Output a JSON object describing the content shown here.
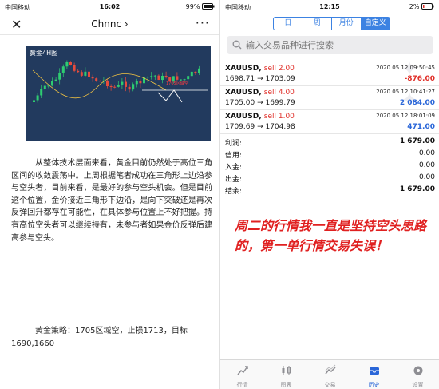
{
  "left": {
    "status": {
      "carrier": "中国移动",
      "time": "16:02",
      "battery": "99%"
    },
    "nav": {
      "title": "Chnnc",
      "close_icon": "close-icon",
      "more_icon": "more-icon"
    },
    "chart": {
      "title": "黄金4H图",
      "annotation": "1705区域空"
    },
    "article": "从整体技术层面来看，黄金目前仍然处于高位三角区间的收敛震荡中。上周根据笔者成功在三角形上边沿参与空头者，目前来看，是最好的参与空头机会。但是目前这个位置，金价接近三角形下边沿，是向下突破还是再次反弹回升都存在可能性，在具体参与位置上不好把握。持有高位空头者可以继续持有，未参与者如果金价反弹后建高参与空头。",
    "strategy": "黄金策略：1705区域空，止损1713，目标1690,1660"
  },
  "right": {
    "status": {
      "carrier": "中国移动",
      "time": "12:15",
      "battery": "2%"
    },
    "segments": [
      "日",
      "周",
      "月份",
      "自定义"
    ],
    "active_segment": 3,
    "search": {
      "placeholder": "输入交易品种进行搜索"
    },
    "orders": [
      {
        "symbol": "XAUUSD,",
        "side": "sell 2.00",
        "prices": "1698.71 → 1703.09",
        "datetime": "2020.05.12 09:50:45",
        "profit": "-876.00",
        "profit_sign": "neg"
      },
      {
        "symbol": "XAUUSD,",
        "side": "sell 4.00",
        "prices": "1705.00 → 1699.79",
        "datetime": "2020.05.12 10:41:27",
        "profit": "2 084.00",
        "profit_sign": "pos"
      },
      {
        "symbol": "XAUUSD,",
        "side": "sell 1.00",
        "prices": "1709.69 → 1704.98",
        "datetime": "2020.05.12 18:01:09",
        "profit": "471.00",
        "profit_sign": "pos"
      }
    ],
    "summary": [
      {
        "key": "利润:",
        "value": "1 679.00"
      },
      {
        "key": "信用:",
        "value": "0.00"
      },
      {
        "key": "入金:",
        "value": "0.00"
      },
      {
        "key": "出金:",
        "value": "0.00"
      },
      {
        "key": "结余:",
        "value": "1 679.00"
      }
    ],
    "note": "周二的行情我一直是坚持空头思路的，第一单行情交易失误！",
    "tabs": [
      {
        "label": "行情",
        "icon": "quotes-icon"
      },
      {
        "label": "图表",
        "icon": "chart-icon"
      },
      {
        "label": "交易",
        "icon": "trade-icon"
      },
      {
        "label": "历史",
        "icon": "history-icon"
      },
      {
        "label": "设置",
        "icon": "settings-icon"
      }
    ],
    "active_tab": 3,
    "colors": {
      "accent": "#3c82e2",
      "sell": "#e0302a",
      "profit": "#2a66d8",
      "loss": "#e0302a"
    }
  }
}
